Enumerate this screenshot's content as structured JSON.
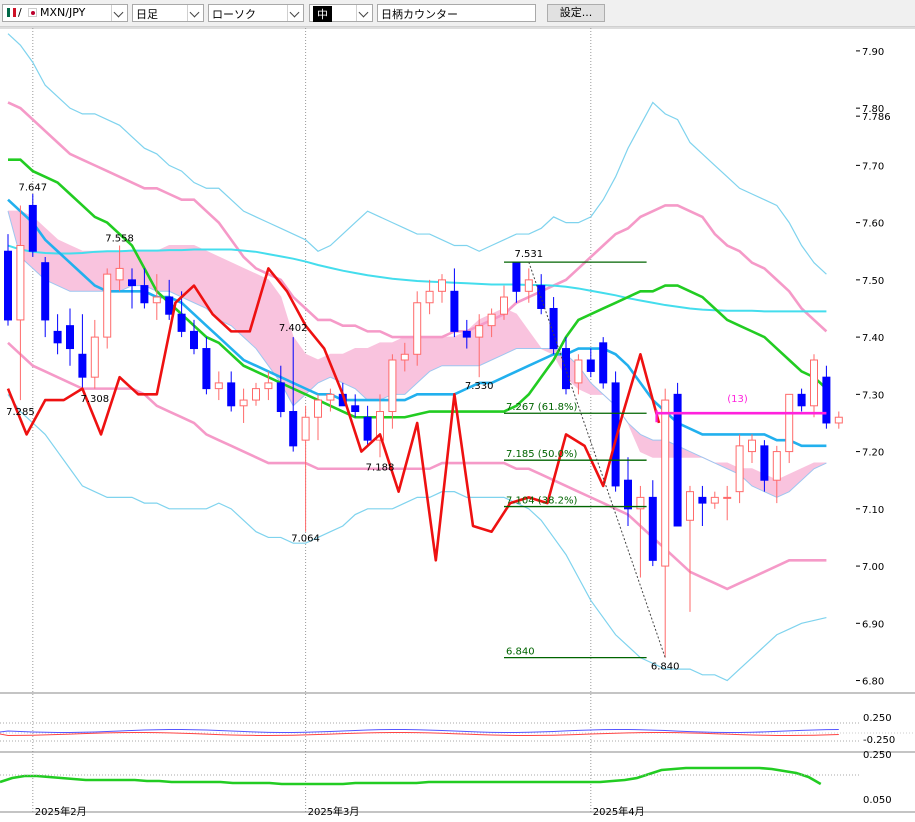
{
  "toolbar": {
    "pair": "MXN/JPY",
    "pair_separator": "/",
    "timeframe": "日足",
    "chart_style": "ローソク",
    "line_weight": "中",
    "counter": "日柄カウンター",
    "settings": "設定..."
  },
  "colors": {
    "candle_up": "#ff6a6a",
    "candle_down": "#0000ff",
    "kumo": "#f9c3de",
    "kumo_border": "#9ec6f0",
    "bb_outer": "#7fd3ee",
    "bb_mid": "#f59ac8",
    "ma_short": "#22cc22",
    "ma_mid": "#22b0ee",
    "ma_long": "#44dded",
    "swing": "#ee1111",
    "fib": "#006400",
    "counter_line": "#ff22dd"
  },
  "chart_data": {
    "type": "candlestick",
    "xlabel": "",
    "ylabel": "",
    "y_ticks": [
      "7.90",
      "7.80",
      "7.786",
      "7.70",
      "7.60",
      "7.50",
      "7.40",
      "7.30",
      "7.20",
      "7.10",
      "7.00",
      "6.90",
      "6.80"
    ],
    "ylim": [
      6.78,
      7.94
    ],
    "x_ticks": [
      "2025年2月",
      "2025年3月",
      "2025年4月"
    ],
    "x_tick_index": [
      2,
      24,
      47
    ],
    "annotations": [
      {
        "i": 2,
        "price": 7.647,
        "label": "7.647",
        "pos": "above"
      },
      {
        "i": 9,
        "price": 7.558,
        "label": "7.558",
        "pos": "above"
      },
      {
        "i": 23,
        "price": 7.402,
        "label": "7.402",
        "pos": "above"
      },
      {
        "i": 1,
        "price": 7.285,
        "label": "7.285",
        "pos": "below"
      },
      {
        "i": 7,
        "price": 7.308,
        "label": "7.308",
        "pos": "below"
      },
      {
        "i": 24,
        "price": 7.064,
        "label": "7.064",
        "pos": "below"
      },
      {
        "i": 30,
        "price": 7.188,
        "label": "7.188",
        "pos": "below"
      },
      {
        "i": 38,
        "price": 7.33,
        "label": "7.330",
        "pos": "below"
      },
      {
        "i": 42,
        "price": 7.531,
        "label": "7.531",
        "pos": "above"
      },
      {
        "i": 53,
        "price": 6.84,
        "label": "6.840",
        "pos": "below"
      }
    ],
    "fib_levels": [
      {
        "label": "7.531",
        "price": 7.531
      },
      {
        "label": "7.267 (61.8%)",
        "price": 7.267
      },
      {
        "label": "7.185 (50.0%)",
        "price": 7.185
      },
      {
        "label": "7.104 (38.2%)",
        "price": 7.104
      },
      {
        "label": "6.840",
        "price": 6.84
      }
    ],
    "counter_label": "(13)",
    "counter_price": 7.267,
    "candles": [
      [
        7.55,
        7.58,
        7.42,
        7.43
      ],
      [
        7.43,
        7.63,
        7.29,
        7.56
      ],
      [
        7.63,
        7.65,
        7.54,
        7.55
      ],
      [
        7.53,
        7.54,
        7.4,
        7.43
      ],
      [
        7.41,
        7.44,
        7.37,
        7.39
      ],
      [
        7.42,
        7.45,
        7.35,
        7.38
      ],
      [
        7.37,
        7.44,
        7.31,
        7.33
      ],
      [
        7.33,
        7.43,
        7.31,
        7.4
      ],
      [
        7.4,
        7.52,
        7.38,
        7.51
      ],
      [
        7.5,
        7.56,
        7.48,
        7.52
      ],
      [
        7.5,
        7.52,
        7.45,
        7.49
      ],
      [
        7.49,
        7.52,
        7.45,
        7.46
      ],
      [
        7.46,
        7.51,
        7.43,
        7.47
      ],
      [
        7.47,
        7.5,
        7.43,
        7.44
      ],
      [
        7.44,
        7.48,
        7.4,
        7.41
      ],
      [
        7.41,
        7.43,
        7.37,
        7.38
      ],
      [
        7.38,
        7.4,
        7.3,
        7.31
      ],
      [
        7.31,
        7.34,
        7.29,
        7.32
      ],
      [
        7.32,
        7.34,
        7.27,
        7.28
      ],
      [
        7.28,
        7.31,
        7.25,
        7.29
      ],
      [
        7.29,
        7.32,
        7.28,
        7.31
      ],
      [
        7.31,
        7.34,
        7.29,
        7.32
      ],
      [
        7.32,
        7.35,
        7.26,
        7.27
      ],
      [
        7.27,
        7.4,
        7.2,
        7.21
      ],
      [
        7.22,
        7.28,
        7.06,
        7.26
      ],
      [
        7.26,
        7.3,
        7.22,
        7.29
      ],
      [
        7.29,
        7.31,
        7.27,
        7.3
      ],
      [
        7.3,
        7.32,
        7.28,
        7.28
      ],
      [
        7.28,
        7.3,
        7.26,
        7.27
      ],
      [
        7.26,
        7.28,
        7.21,
        7.22
      ],
      [
        7.22,
        7.3,
        7.19,
        7.27
      ],
      [
        7.27,
        7.37,
        7.24,
        7.36
      ],
      [
        7.36,
        7.39,
        7.34,
        7.37
      ],
      [
        7.37,
        7.48,
        7.35,
        7.46
      ],
      [
        7.46,
        7.5,
        7.44,
        7.48
      ],
      [
        7.48,
        7.51,
        7.46,
        7.5
      ],
      [
        7.48,
        7.52,
        7.4,
        7.41
      ],
      [
        7.41,
        7.43,
        7.38,
        7.4
      ],
      [
        7.4,
        7.44,
        7.33,
        7.42
      ],
      [
        7.42,
        7.45,
        7.4,
        7.44
      ],
      [
        7.44,
        7.49,
        7.43,
        7.47
      ],
      [
        7.53,
        7.53,
        7.46,
        7.48
      ],
      [
        7.48,
        7.52,
        7.46,
        7.5
      ],
      [
        7.49,
        7.51,
        7.44,
        7.45
      ],
      [
        7.45,
        7.47,
        7.37,
        7.38
      ],
      [
        7.38,
        7.4,
        7.3,
        7.31
      ],
      [
        7.32,
        7.37,
        7.3,
        7.36
      ],
      [
        7.36,
        7.38,
        7.33,
        7.34
      ],
      [
        7.39,
        7.4,
        7.31,
        7.32
      ],
      [
        7.32,
        7.34,
        7.13,
        7.14
      ],
      [
        7.15,
        7.19,
        7.07,
        7.1
      ],
      [
        7.1,
        7.14,
        6.98,
        7.12
      ],
      [
        7.12,
        7.15,
        7.0,
        7.01
      ],
      [
        7.0,
        7.31,
        6.84,
        7.29
      ],
      [
        7.3,
        7.32,
        7.07,
        7.07
      ],
      [
        7.08,
        7.14,
        6.92,
        7.13
      ],
      [
        7.12,
        7.14,
        7.07,
        7.11
      ],
      [
        7.11,
        7.13,
        7.1,
        7.12
      ],
      [
        7.12,
        7.14,
        7.08,
        7.12
      ],
      [
        7.13,
        7.23,
        7.11,
        7.21
      ],
      [
        7.2,
        7.23,
        7.18,
        7.22
      ],
      [
        7.21,
        7.22,
        7.13,
        7.15
      ],
      [
        7.15,
        7.21,
        7.11,
        7.2
      ],
      [
        7.2,
        7.3,
        7.18,
        7.3
      ],
      [
        7.3,
        7.31,
        7.27,
        7.28
      ],
      [
        7.28,
        7.37,
        7.26,
        7.36
      ],
      [
        7.33,
        7.35,
        7.24,
        7.25
      ],
      [
        7.25,
        7.27,
        7.24,
        7.26
      ]
    ],
    "series": [
      {
        "name": "",
        "kind": "ma_long",
        "y": [
          7.56,
          7.553,
          7.549,
          7.547,
          7.546,
          7.546,
          7.547,
          7.549,
          7.55,
          7.55,
          7.551,
          7.551,
          7.551,
          7.552,
          7.552,
          7.553,
          7.553,
          7.553,
          7.553,
          7.551,
          7.549,
          7.545,
          7.541,
          7.537,
          7.532,
          7.526,
          7.521,
          7.516,
          7.512,
          7.508,
          7.505,
          7.502,
          7.5,
          7.498,
          7.497,
          7.496,
          7.495,
          7.494,
          7.493,
          7.492,
          7.492,
          7.492,
          7.491,
          7.491,
          7.49,
          7.488,
          7.485,
          7.481,
          7.477,
          7.473,
          7.468,
          7.464,
          7.46,
          7.456,
          7.453,
          7.45,
          7.448,
          7.447,
          7.446,
          7.446,
          7.446,
          7.445,
          7.445,
          7.445,
          7.445,
          7.445,
          7.445
        ]
      },
      {
        "name": "",
        "kind": "ma_mid",
        "y": [
          7.64,
          7.62,
          7.6,
          7.57,
          7.55,
          7.53,
          7.51,
          7.49,
          7.48,
          7.48,
          7.48,
          7.48,
          7.47,
          7.47,
          7.46,
          7.44,
          7.42,
          7.4,
          7.38,
          7.36,
          7.35,
          7.34,
          7.33,
          7.32,
          7.31,
          7.3,
          7.3,
          7.29,
          7.29,
          7.29,
          7.29,
          7.29,
          7.29,
          7.3,
          7.3,
          7.3,
          7.3,
          7.31,
          7.32,
          7.32,
          7.33,
          7.34,
          7.35,
          7.36,
          7.37,
          7.37,
          7.38,
          7.38,
          7.38,
          7.37,
          7.35,
          7.32,
          7.29,
          7.27,
          7.25,
          7.24,
          7.23,
          7.23,
          7.23,
          7.23,
          7.23,
          7.23,
          7.22,
          7.22,
          7.21,
          7.21,
          7.21
        ]
      },
      {
        "name": "",
        "kind": "ma_short",
        "y": [
          7.71,
          7.71,
          7.69,
          7.68,
          7.67,
          7.65,
          7.63,
          7.61,
          7.6,
          7.58,
          7.56,
          7.52,
          7.48,
          7.46,
          7.44,
          7.42,
          7.4,
          7.39,
          7.37,
          7.35,
          7.34,
          7.33,
          7.32,
          7.31,
          7.3,
          7.29,
          7.28,
          7.27,
          7.26,
          7.26,
          7.26,
          7.26,
          7.26,
          7.265,
          7.27,
          7.27,
          7.27,
          7.27,
          7.27,
          7.27,
          7.27,
          7.28,
          7.3,
          7.33,
          7.36,
          7.4,
          7.43,
          7.44,
          7.45,
          7.46,
          7.47,
          7.48,
          7.48,
          7.49,
          7.49,
          7.48,
          7.47,
          7.45,
          7.43,
          7.42,
          7.41,
          7.4,
          7.38,
          7.36,
          7.34,
          7.33,
          7.31
        ]
      },
      {
        "name": "",
        "kind": "bb_upper2",
        "y": [
          7.93,
          7.91,
          7.88,
          7.84,
          7.82,
          7.8,
          7.79,
          7.79,
          7.78,
          7.77,
          7.75,
          7.73,
          7.72,
          7.7,
          7.69,
          7.67,
          7.66,
          7.66,
          7.64,
          7.62,
          7.61,
          7.6,
          7.59,
          7.58,
          7.57,
          7.55,
          7.56,
          7.58,
          7.6,
          7.62,
          7.61,
          7.6,
          7.59,
          7.58,
          7.58,
          7.57,
          7.56,
          7.56,
          7.55,
          7.56,
          7.57,
          7.58,
          7.58,
          7.59,
          7.61,
          7.6,
          7.6,
          7.61,
          7.64,
          7.68,
          7.73,
          7.77,
          7.81,
          7.79,
          7.78,
          7.74,
          7.72,
          7.7,
          7.68,
          7.66,
          7.65,
          7.64,
          7.63,
          7.6,
          7.56,
          7.53,
          7.51
        ]
      },
      {
        "name": "",
        "kind": "bb_upper1",
        "y": [
          7.81,
          7.8,
          7.78,
          7.76,
          7.74,
          7.72,
          7.71,
          7.7,
          7.69,
          7.68,
          7.67,
          7.66,
          7.66,
          7.65,
          7.64,
          7.64,
          7.62,
          7.6,
          7.57,
          7.54,
          7.52,
          7.51,
          7.5,
          7.47,
          7.45,
          7.43,
          7.43,
          7.42,
          7.42,
          7.41,
          7.41,
          7.4,
          7.4,
          7.4,
          7.4,
          7.4,
          7.41,
          7.41,
          7.42,
          7.43,
          7.44,
          7.46,
          7.47,
          7.48,
          7.49,
          7.5,
          7.52,
          7.54,
          7.56,
          7.58,
          7.59,
          7.61,
          7.62,
          7.63,
          7.63,
          7.62,
          7.61,
          7.58,
          7.56,
          7.55,
          7.53,
          7.52,
          7.5,
          7.48,
          7.45,
          7.43,
          7.41
        ]
      },
      {
        "name": "",
        "kind": "bb_lower1",
        "y": [
          7.39,
          7.37,
          7.35,
          7.34,
          7.33,
          7.32,
          7.31,
          7.31,
          7.31,
          7.31,
          7.31,
          7.3,
          7.28,
          7.27,
          7.26,
          7.25,
          7.23,
          7.22,
          7.21,
          7.2,
          7.19,
          7.18,
          7.18,
          7.18,
          7.18,
          7.17,
          7.17,
          7.17,
          7.17,
          7.17,
          7.17,
          7.17,
          7.17,
          7.17,
          7.17,
          7.18,
          7.18,
          7.18,
          7.18,
          7.18,
          7.18,
          7.17,
          7.17,
          7.16,
          7.15,
          7.14,
          7.13,
          7.12,
          7.11,
          7.1,
          7.09,
          7.07,
          7.05,
          7.03,
          7.01,
          6.99,
          6.98,
          6.97,
          6.96,
          6.97,
          6.98,
          6.99,
          7.0,
          7.01,
          7.01,
          7.01,
          7.01
        ]
      },
      {
        "name": "",
        "kind": "bb_lower2",
        "y": [
          7.3,
          7.27,
          7.25,
          7.23,
          7.2,
          7.17,
          7.14,
          7.13,
          7.12,
          7.12,
          7.12,
          7.11,
          7.11,
          7.1,
          7.1,
          7.1,
          7.1,
          7.11,
          7.1,
          7.08,
          7.06,
          7.05,
          7.05,
          7.04,
          7.04,
          7.05,
          7.06,
          7.07,
          7.09,
          7.1,
          7.1,
          7.1,
          7.11,
          7.12,
          7.12,
          7.13,
          7.13,
          7.12,
          7.12,
          7.12,
          7.12,
          7.11,
          7.1,
          7.08,
          7.05,
          7.02,
          6.98,
          6.94,
          6.91,
          6.88,
          6.86,
          6.84,
          6.83,
          6.82,
          6.82,
          6.82,
          6.81,
          6.81,
          6.8,
          6.82,
          6.84,
          6.86,
          6.88,
          6.89,
          6.9,
          6.905,
          6.91
        ]
      },
      {
        "name": "",
        "kind": "kumo_a",
        "y": [
          7.62,
          7.62,
          7.61,
          7.59,
          7.57,
          7.56,
          7.55,
          7.55,
          7.55,
          7.55,
          7.55,
          7.55,
          7.55,
          7.56,
          7.56,
          7.56,
          7.55,
          7.54,
          7.53,
          7.52,
          7.51,
          7.5,
          7.47,
          7.4,
          7.37,
          7.36,
          7.37,
          7.37,
          7.38,
          7.38,
          7.39,
          7.39,
          7.4,
          7.4,
          7.4,
          7.4,
          7.4,
          7.41,
          7.43,
          7.44,
          7.45,
          7.44,
          7.41,
          7.38,
          7.37,
          7.33,
          7.31,
          7.3,
          7.3,
          7.28,
          7.25,
          7.2,
          7.19,
          7.19,
          7.19,
          7.19,
          7.19,
          7.18,
          7.18,
          7.17,
          7.17,
          7.16,
          7.15,
          7.16,
          7.17,
          7.18,
          7.18
        ]
      },
      {
        "name": "",
        "kind": "kumo_b",
        "y": [
          7.62,
          7.54,
          7.52,
          7.5,
          7.49,
          7.48,
          7.48,
          7.48,
          7.48,
          7.48,
          7.49,
          7.49,
          7.48,
          7.48,
          7.47,
          7.46,
          7.45,
          7.43,
          7.42,
          7.4,
          7.38,
          7.35,
          7.32,
          7.28,
          7.3,
          7.32,
          7.33,
          7.32,
          7.31,
          7.29,
          7.29,
          7.3,
          7.3,
          7.32,
          7.34,
          7.35,
          7.35,
          7.35,
          7.35,
          7.36,
          7.37,
          7.38,
          7.38,
          7.38,
          7.38,
          7.37,
          7.35,
          7.32,
          7.3,
          7.28,
          7.25,
          7.23,
          7.22,
          7.22,
          7.21,
          7.2,
          7.19,
          7.18,
          7.17,
          7.16,
          7.14,
          7.13,
          7.12,
          7.13,
          7.15,
          7.17,
          7.18
        ]
      },
      {
        "name": "",
        "kind": "swing",
        "y": [
          7.31,
          7.23,
          7.29,
          7.29,
          7.31,
          7.23,
          7.33,
          7.3,
          7.3,
          7.46,
          7.49,
          7.44,
          7.41,
          7.41,
          7.52,
          7.48,
          7.42,
          7.38,
          7.3,
          7.2,
          7.23,
          7.13,
          7.25,
          7.01,
          7.3,
          7.07,
          7.06,
          7.11,
          7.12,
          7.11,
          7.23,
          7.21,
          7.14,
          7.26,
          7.37,
          7.25
        ]
      }
    ],
    "sub1_ticks": [
      "0.250",
      "-0.250"
    ],
    "sub2_ticks": [
      "0.250",
      "0.050"
    ]
  }
}
